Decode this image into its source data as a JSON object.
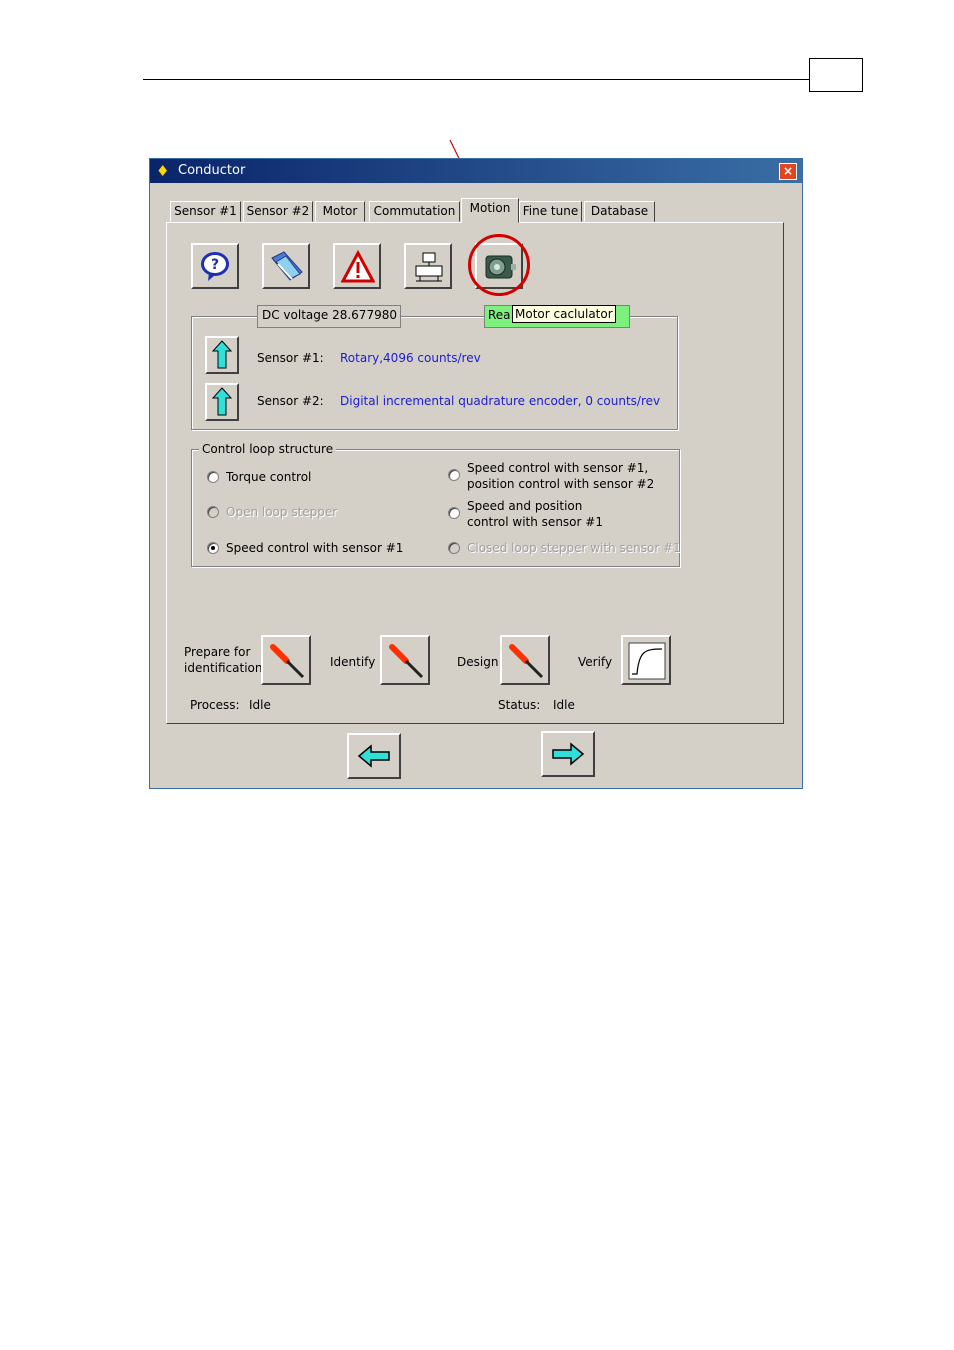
{
  "window": {
    "title": "Conductor",
    "close_label": "×"
  },
  "tabs": [
    {
      "label": "Sensor #1"
    },
    {
      "label": "Sensor #2"
    },
    {
      "label": "Motor"
    },
    {
      "label": "Commutation"
    },
    {
      "label": "Motion",
      "active": true
    },
    {
      "label": "Fine tune"
    },
    {
      "label": "Database"
    }
  ],
  "toolbar": {
    "buttons": [
      {
        "icon": "help-icon"
      },
      {
        "icon": "books-icon"
      },
      {
        "icon": "warning-icon"
      },
      {
        "icon": "network-icon"
      },
      {
        "icon": "motor-icon"
      }
    ],
    "tooltip": "Motor caclulator"
  },
  "status_fields": {
    "dc_voltage": "DC voltage 28.677980",
    "ready": "Rea"
  },
  "sensors": [
    {
      "label": "Sensor #1:",
      "value": "Rotary,4096  counts/rev"
    },
    {
      "label": "Sensor #2:",
      "value": "Digital incremental quadrature encoder, 0 counts/rev"
    }
  ],
  "control_loop": {
    "caption": "Control loop structure",
    "options": [
      {
        "label": "Torque control",
        "checked": false,
        "enabled": true
      },
      {
        "label": "Open loop stepper",
        "checked": false,
        "enabled": false
      },
      {
        "label": "Speed control with sensor #1",
        "checked": true,
        "enabled": true
      },
      {
        "label_line1": "Speed control with sensor #1,",
        "label_line2": "position control with sensor #2",
        "checked": false,
        "enabled": true
      },
      {
        "label_line1": "Speed and position",
        "label_line2": "control with sensor #1",
        "checked": false,
        "enabled": true
      },
      {
        "label": "Closed loop stepper with sensor #1",
        "checked": false,
        "enabled": false
      }
    ]
  },
  "actions": {
    "prepare_line1": "Prepare for",
    "prepare_line2": "identification",
    "identify": "Identify",
    "design": "Design",
    "verify": "Verify"
  },
  "status": {
    "process_label": "Process:",
    "process_value": "Idle",
    "status_label": "Status:",
    "status_value": "Idle"
  },
  "colors": {
    "title_bar": "#0a246a",
    "window_bg": "#d4d0c8",
    "value_text": "#1c1cd0",
    "ready_green": "#7df07d",
    "callout_red": "#d40000"
  }
}
